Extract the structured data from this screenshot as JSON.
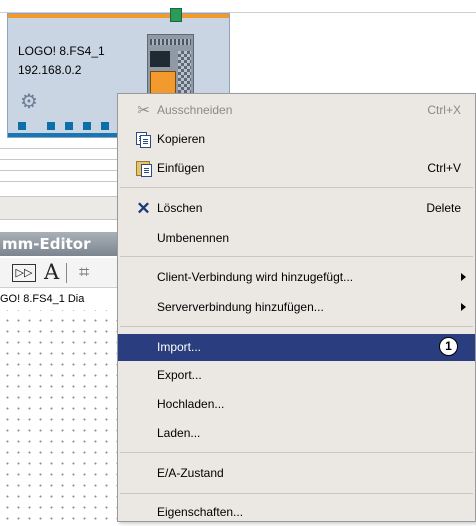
{
  "device": {
    "name": "LOGO! 8.FS4_1",
    "ip": "192.168.0.2"
  },
  "editor": {
    "title_partial": "mm-Editor",
    "toolbar_text_tool": "A",
    "tab_label_partial": "GO! 8.FS4_1 Dia"
  },
  "context_menu": {
    "items": [
      {
        "label": "Ausschneiden",
        "shortcut": "Ctrl+X",
        "icon": "scissors-icon",
        "disabled": true
      },
      {
        "label": "Kopieren",
        "shortcut": "",
        "icon": "copy-icon"
      },
      {
        "label": "Einfügen",
        "shortcut": "Ctrl+V",
        "icon": "paste-icon"
      },
      {
        "label": "Löschen",
        "shortcut": "Delete",
        "icon": "delete-icon"
      },
      {
        "label": "Umbenennen",
        "shortcut": ""
      },
      {
        "label": "Client-Verbindung wird hinzugefügt...",
        "submenu": true
      },
      {
        "label": "Serververbindung hinzufügen...",
        "submenu": true
      },
      {
        "label": "Import...",
        "highlighted": true,
        "callout": "1"
      },
      {
        "label": "Export..."
      },
      {
        "label": "Hochladen..."
      },
      {
        "label": "Laden..."
      },
      {
        "label": "E/A-Zustand"
      },
      {
        "label": "Eigenschaften..."
      }
    ]
  },
  "colors": {
    "menu_highlight": "#2a3d7e",
    "menu_background": "#ebe8e4",
    "device_accent": "#f39a2c",
    "device_card": "#cad5e3"
  }
}
